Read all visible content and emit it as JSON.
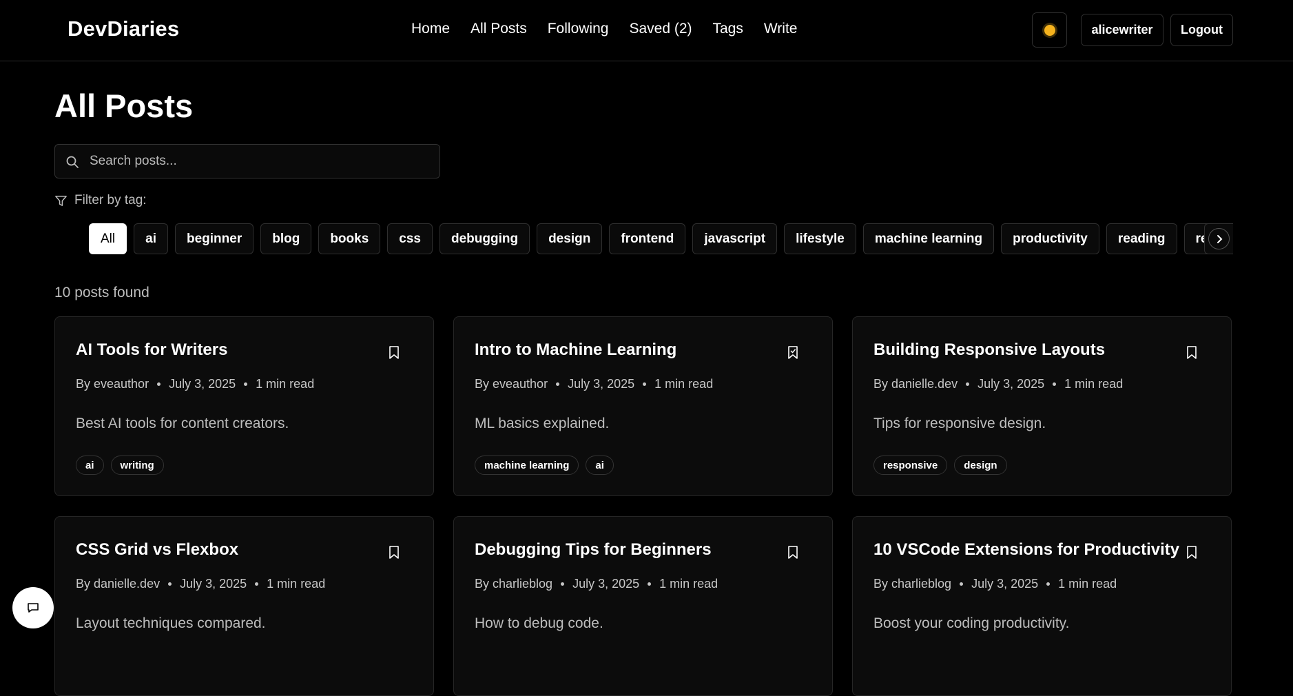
{
  "header": {
    "logo": "DevDiaries",
    "nav": [
      "Home",
      "All Posts",
      "Following",
      "Saved (2)",
      "Tags",
      "Write"
    ],
    "user": "alicewriter",
    "logout": "Logout"
  },
  "main": {
    "title": "All Posts",
    "search_placeholder": "Search posts...",
    "filter_label": "Filter by tag:",
    "tags": [
      "All",
      "ai",
      "beginner",
      "blog",
      "books",
      "css",
      "debugging",
      "design",
      "frontend",
      "javascript",
      "lifestyle",
      "machine learning",
      "productivity",
      "reading",
      "responsive"
    ],
    "active_tag": "All",
    "count": "10 posts found"
  },
  "posts": [
    {
      "title": "AI Tools for Writers",
      "author": "By eveauthor",
      "date": "July 3, 2025",
      "read": "1 min read",
      "desc": "Best AI tools for content creators.",
      "tags": [
        "ai",
        "writing"
      ],
      "saved": false
    },
    {
      "title": "Intro to Machine Learning",
      "author": "By eveauthor",
      "date": "July 3, 2025",
      "read": "1 min read",
      "desc": "ML basics explained.",
      "tags": [
        "machine learning",
        "ai"
      ],
      "saved": true
    },
    {
      "title": "Building Responsive Layouts",
      "author": "By danielle.dev",
      "date": "July 3, 2025",
      "read": "1 min read",
      "desc": "Tips for responsive design.",
      "tags": [
        "responsive",
        "design"
      ],
      "saved": false
    },
    {
      "title": "CSS Grid vs Flexbox",
      "author": "By danielle.dev",
      "date": "July 3, 2025",
      "read": "1 min read",
      "desc": "Layout techniques compared.",
      "tags": [],
      "saved": false
    },
    {
      "title": "Debugging Tips for Beginners",
      "author": "By charlieblog",
      "date": "July 3, 2025",
      "read": "1 min read",
      "desc": "How to debug code.",
      "tags": [],
      "saved": false
    },
    {
      "title": "10 VSCode Extensions for Productivity",
      "author": "By charlieblog",
      "date": "July 3, 2025",
      "read": "1 min read",
      "desc": "Boost your coding productivity.",
      "tags": [],
      "saved": false
    }
  ],
  "icons": {
    "theme": "sun-icon",
    "search": "search-icon",
    "filter": "filter-icon",
    "bookmark": "bookmark-icon",
    "chat": "chat-icon",
    "next": "chevron-right-icon"
  },
  "colors": {
    "background": "#000000",
    "card": "#0c0c0c",
    "accent_sun": "#f5b21d"
  }
}
